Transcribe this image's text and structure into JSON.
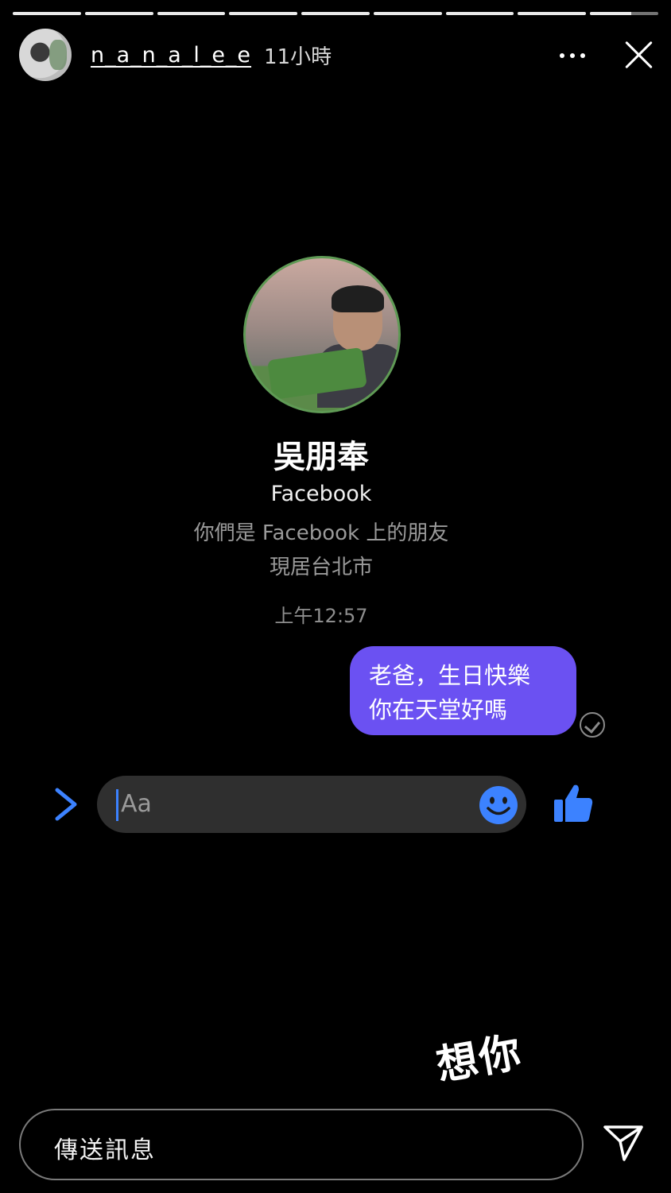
{
  "story": {
    "segments": [
      1,
      1,
      1,
      1,
      1,
      1,
      1,
      1,
      0.6
    ]
  },
  "header": {
    "username": "n_a_n_a_l_e_e",
    "time_ago": "11小時"
  },
  "messenger": {
    "contact_name": "吳朋奉",
    "platform": "Facebook",
    "friend_note": "你們是 Facebook 上的朋友",
    "location": "現居台北市",
    "timestamp": "上午12:57",
    "message_line1": "老爸，生日快樂",
    "message_line2": "你在天堂好嗎",
    "compose_placeholder": "Aa"
  },
  "sticker_text": "想你",
  "reply": {
    "placeholder": "傳送訊息"
  },
  "colors": {
    "bubble": "#6b51f2",
    "accent_blue": "#3c82ff",
    "background": "#000000"
  },
  "icons": [
    "more-icon",
    "close-icon",
    "chevron-right-icon",
    "emoji-icon",
    "thumbs-up-icon",
    "send-icon",
    "seen-check-icon"
  ]
}
